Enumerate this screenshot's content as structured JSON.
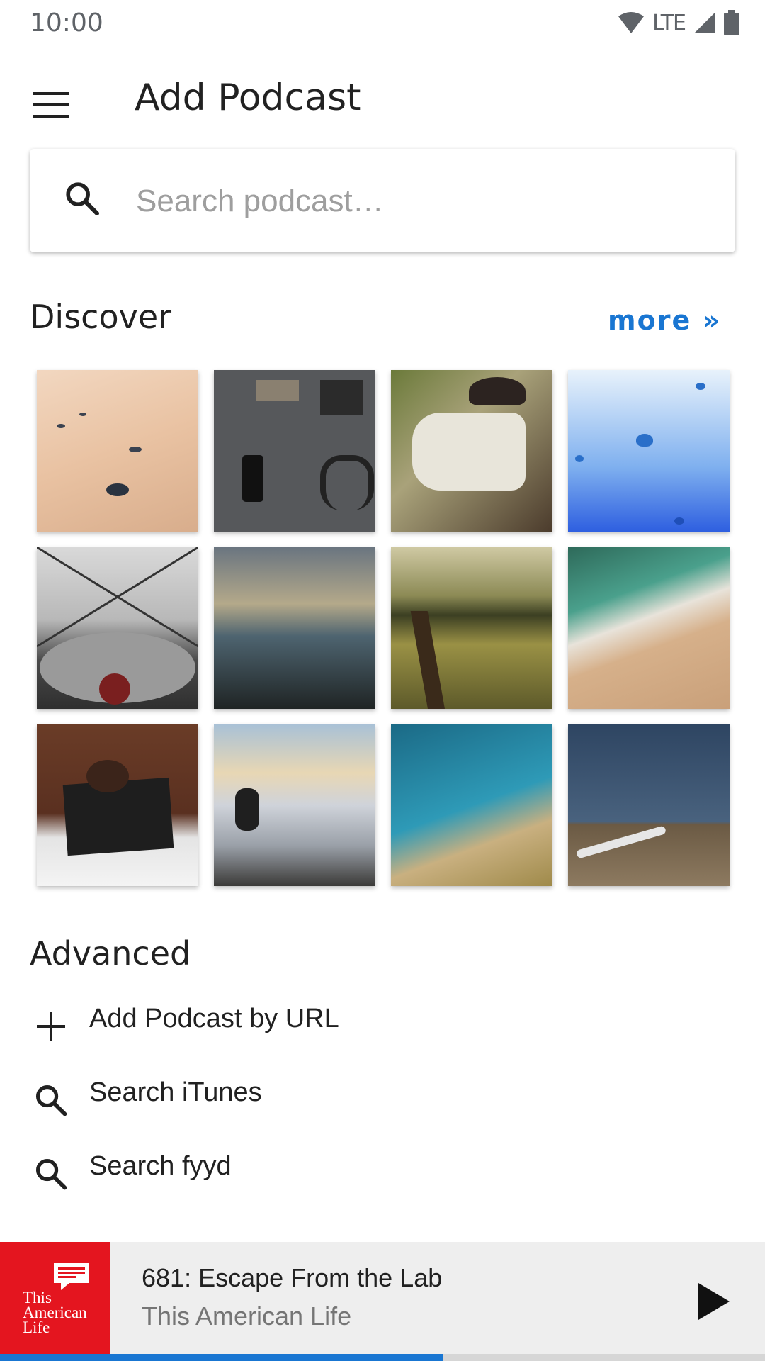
{
  "status": {
    "time": "10:00",
    "network": "LTE"
  },
  "header": {
    "title": "Add Podcast",
    "menu_icon": "menu-icon"
  },
  "search": {
    "placeholder": "Search podcast…",
    "icon": "search-icon"
  },
  "discover": {
    "title": "Discover",
    "more_label": "more »",
    "tiles": [
      "Sand with pebbles",
      "Flat lay of accessories",
      "Man resting in car",
      "Blue jellyfish",
      "City skyline from building",
      "Waves on a shore",
      "Path through a meadow",
      "Aerial beach with waves",
      "Child reading a bible",
      "Person above the clouds",
      "Aerial coastline",
      "Dirt road in a field"
    ]
  },
  "advanced": {
    "title": "Advanced",
    "items": [
      {
        "label": "Add Podcast by URL",
        "icon": "plus-icon"
      },
      {
        "label": "Search iTunes",
        "icon": "search-icon"
      },
      {
        "label": "Search fyyd",
        "icon": "search-icon"
      }
    ]
  },
  "player": {
    "episode_title": "681: Escape From the Lab",
    "podcast_name": "This American Life",
    "art_text_line1": "This",
    "art_text_line2": "American",
    "art_text_line3": "Life",
    "play_icon": "play-icon",
    "progress": 0.58
  },
  "colors": {
    "accent": "#1976d2",
    "art_red": "#e4151f"
  }
}
